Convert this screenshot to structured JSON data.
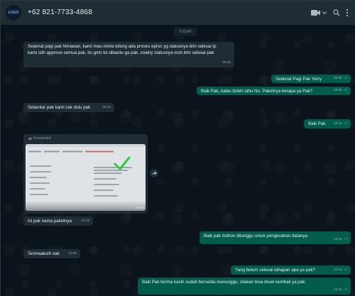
{
  "header": {
    "contact_name": "+62 821-7733-4868",
    "avatar_logo": "LOGO",
    "icons": [
      "video-call-icon",
      "chevron-down-icon",
      "search-icon",
      "menu-icon"
    ]
  },
  "chat": {
    "date_chip": "TODAY",
    "messages": [
      {
        "dir": "in",
        "text": "Selamat pagi pak himawan, kami mau minta tolong ada proses eproc yg statusnya blm selesai tp kami sdh approve semua pak, itu gmn bs dibantu ga pak, soalny statusnya msh blm selesai pak",
        "time": "09:45"
      },
      {
        "dir": "out",
        "text": "Selamat Pagi Pak Yerry",
        "time": "09:59"
      },
      {
        "dir": "out",
        "text": "Baik Pak, kalau boleh tahu No. Paketnya berapa ya Pak?",
        "time": "09:59"
      },
      {
        "dir": "in",
        "text": "Sebentar pak kami cek dulu pak",
        "time": "10:10"
      },
      {
        "dir": "out",
        "text": "Baik Pak",
        "time": "10:18"
      },
      {
        "dir": "in",
        "forwarded_label": "Forwarded",
        "image": true,
        "time": "10:18"
      },
      {
        "dir": "in",
        "text": "ini pak nama paketnya",
        "time": "10:18"
      },
      {
        "dir": "out",
        "text": "Baik pak mohon ditunggu untuk pengecekan datanya.",
        "time": "10:18"
      },
      {
        "dir": "in",
        "text": "Terimaaksih oak",
        "time": "10:20"
      },
      {
        "dir": "out",
        "text": "Yang belum selesai tahapan apa ya pak?",
        "time": "10:23"
      },
      {
        "dir": "out",
        "text": "Baik Pak terima kasih sudah bersedia menunggu, silakan bisa dicek kembali ya pak.",
        "time": "10:25"
      }
    ]
  },
  "colors": {
    "header_bg": "#202c33",
    "chat_bg": "#0b141a",
    "incoming_bubble": "#202c33",
    "outgoing_bubble": "#005c4b",
    "read_ticks": "#53bdeb"
  }
}
